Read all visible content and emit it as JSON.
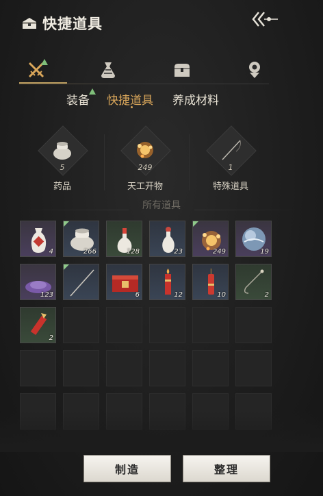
{
  "header": {
    "title": "快捷道具"
  },
  "categories": [
    {
      "icon": "crossed-swords-icon",
      "active": true,
      "badge": true
    },
    {
      "icon": "pouch-icon",
      "active": false
    },
    {
      "icon": "chest-icon",
      "active": false
    },
    {
      "icon": "medal-icon",
      "active": false
    }
  ],
  "subtabs": [
    {
      "label": "装备",
      "active": false,
      "badge": true
    },
    {
      "label": "快捷道具",
      "active": true
    },
    {
      "label": "养成材料",
      "active": false
    }
  ],
  "summary": [
    {
      "icon": "medicine-jar-icon",
      "count": "5",
      "label": "药品"
    },
    {
      "icon": "firework-icon",
      "count": "249",
      "label": "天工开物"
    },
    {
      "icon": "fishing-rod-icon",
      "count": "1",
      "label": "特殊道具"
    }
  ],
  "all_items_label": "所有道具",
  "items": [
    {
      "icon": "red-vase-icon",
      "qty": "4",
      "rarity": "purple",
      "new": false
    },
    {
      "icon": "white-jar-icon",
      "qty": "266",
      "rarity": "blue",
      "new": true
    },
    {
      "icon": "white-bottle-icon",
      "qty": "128",
      "rarity": "green",
      "new": false
    },
    {
      "icon": "white-vase-icon",
      "qty": "23",
      "rarity": "blue",
      "new": false
    },
    {
      "icon": "firework-icon",
      "qty": "249",
      "rarity": "purple",
      "new": true
    },
    {
      "icon": "blue-orb-icon",
      "qty": "19",
      "rarity": "purple",
      "new": false
    },
    {
      "icon": "purple-powder-icon",
      "qty": "123",
      "rarity": "purple",
      "new": false
    },
    {
      "icon": "needle-icon",
      "qty": "",
      "rarity": "blue",
      "new": true
    },
    {
      "icon": "red-box-icon",
      "qty": "6",
      "rarity": "blue",
      "new": false
    },
    {
      "icon": "red-candle-icon",
      "qty": "12",
      "rarity": "blue",
      "new": false
    },
    {
      "icon": "red-firecracker-icon",
      "qty": "10",
      "rarity": "blue",
      "new": false
    },
    {
      "icon": "hook-icon",
      "qty": "2",
      "rarity": "green",
      "new": false
    },
    {
      "icon": "rocket-icon",
      "qty": "2",
      "rarity": "green",
      "new": false
    }
  ],
  "buttons": {
    "craft": "制造",
    "sort": "整理"
  }
}
